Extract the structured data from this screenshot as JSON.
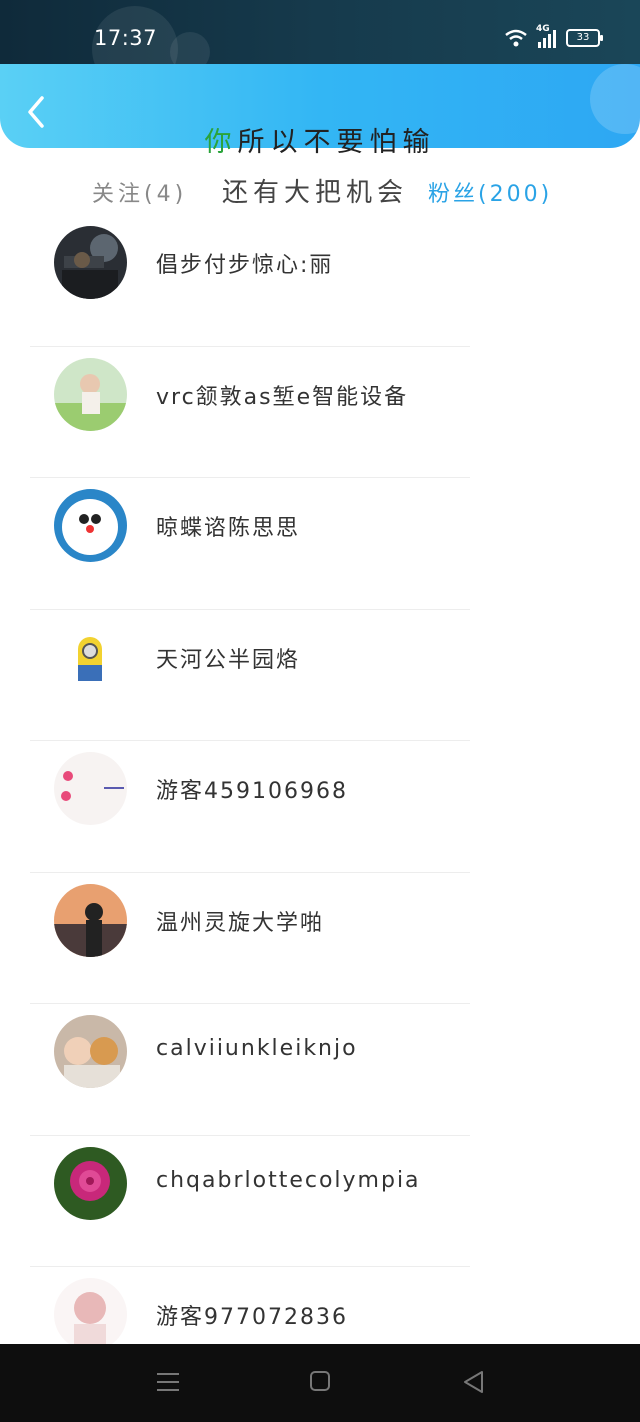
{
  "status_bar": {
    "time": "17:37",
    "network": "4G",
    "battery": "33"
  },
  "header": {
    "back_icon": "chevron-left-icon",
    "title_first": "你",
    "title_rest": "所以不要怕输",
    "subtitle": "还有大把机会"
  },
  "tabs": {
    "follow": "关注(4)",
    "fans": "粉丝(200)"
  },
  "users": [
    {
      "name": "倡步付步惊心:丽"
    },
    {
      "name": "vrc颔敦as堑e智能设备"
    },
    {
      "name": "晾蝶谘陈思思"
    },
    {
      "name": "天河公半园烙"
    },
    {
      "name": "游客459106968"
    },
    {
      "name": "温州灵旋大学啪"
    },
    {
      "name": "calviiunkleiknjo"
    },
    {
      "name": "chqabrlottecolympia"
    },
    {
      "name": "游客977072836"
    }
  ],
  "nav": {
    "menu": "menu-icon",
    "home": "home-square-icon",
    "back": "back-triangle-icon"
  },
  "colors": {
    "header_start": "#5ad0f5",
    "header_end": "#2da7f3",
    "fans_tab": "#2aa3e6",
    "title_accent": "#2aa33a"
  }
}
